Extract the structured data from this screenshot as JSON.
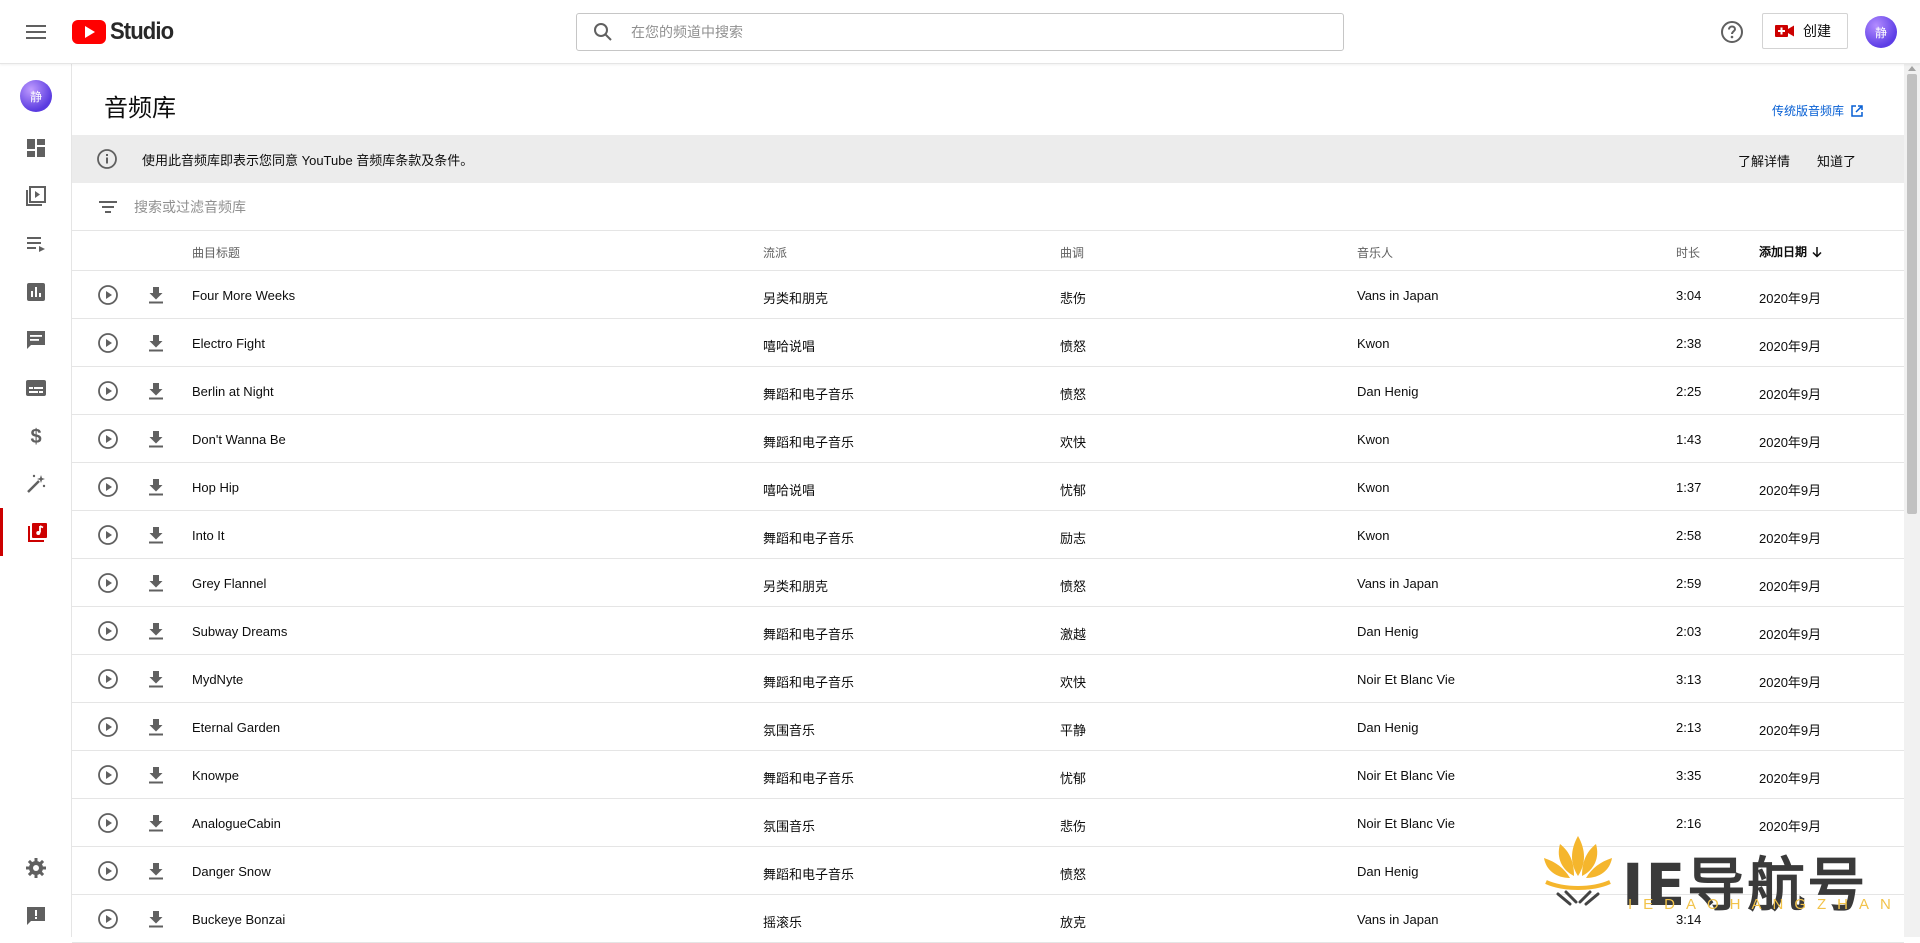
{
  "header": {
    "logo_text": "Studio",
    "search_placeholder": "在您的频道中搜索",
    "create_label": "创建",
    "avatar_text": "静"
  },
  "sidebar": {
    "avatar_text": "静",
    "items": [
      {
        "name": "dashboard"
      },
      {
        "name": "content"
      },
      {
        "name": "playlists"
      },
      {
        "name": "analytics"
      },
      {
        "name": "comments"
      },
      {
        "name": "subtitles"
      },
      {
        "name": "monetization"
      },
      {
        "name": "customization"
      },
      {
        "name": "audio-library",
        "active": true
      }
    ]
  },
  "page": {
    "title": "音频库",
    "legacy_link": "传统版音频库",
    "notice_text": "使用此音频库即表示您同意 YouTube 音频库条款及条件。",
    "learn_more": "了解详情",
    "got_it": "知道了",
    "filter_placeholder": "搜索或过滤音频库"
  },
  "table": {
    "headers": {
      "title": "曲目标题",
      "genre": "流派",
      "mood": "曲调",
      "artist": "音乐人",
      "duration": "时长",
      "date": "添加日期"
    },
    "rows": [
      {
        "title": "Four More Weeks",
        "genre": "另类和朋克",
        "mood": "悲伤",
        "artist": "Vans in Japan",
        "duration": "3:04",
        "date": "2020年9月"
      },
      {
        "title": "Electro Fight",
        "genre": "嘻哈说唱",
        "mood": "愤怒",
        "artist": "Kwon",
        "duration": "2:38",
        "date": "2020年9月"
      },
      {
        "title": "Berlin at Night",
        "genre": "舞蹈和电子音乐",
        "mood": "愤怒",
        "artist": "Dan Henig",
        "duration": "2:25",
        "date": "2020年9月"
      },
      {
        "title": "Don't Wanna Be",
        "genre": "舞蹈和电子音乐",
        "mood": "欢快",
        "artist": "Kwon",
        "duration": "1:43",
        "date": "2020年9月"
      },
      {
        "title": "Hop Hip",
        "genre": "嘻哈说唱",
        "mood": "忧郁",
        "artist": "Kwon",
        "duration": "1:37",
        "date": "2020年9月"
      },
      {
        "title": "Into It",
        "genre": "舞蹈和电子音乐",
        "mood": "励志",
        "artist": "Kwon",
        "duration": "2:58",
        "date": "2020年9月"
      },
      {
        "title": "Grey Flannel",
        "genre": "另类和朋克",
        "mood": "愤怒",
        "artist": "Vans in Japan",
        "duration": "2:59",
        "date": "2020年9月"
      },
      {
        "title": "Subway Dreams",
        "genre": "舞蹈和电子音乐",
        "mood": "激越",
        "artist": "Dan Henig",
        "duration": "2:03",
        "date": "2020年9月"
      },
      {
        "title": "MydNyte",
        "genre": "舞蹈和电子音乐",
        "mood": "欢快",
        "artist": "Noir Et Blanc Vie",
        "duration": "3:13",
        "date": "2020年9月"
      },
      {
        "title": "Eternal Garden",
        "genre": "氛围音乐",
        "mood": "平静",
        "artist": "Dan Henig",
        "duration": "2:13",
        "date": "2020年9月"
      },
      {
        "title": "Knowpe",
        "genre": "舞蹈和电子音乐",
        "mood": "忧郁",
        "artist": "Noir Et Blanc Vie",
        "duration": "3:35",
        "date": "2020年9月"
      },
      {
        "title": "AnalogueCabin",
        "genre": "氛围音乐",
        "mood": "悲伤",
        "artist": "Noir Et Blanc Vie",
        "duration": "2:16",
        "date": "2020年9月"
      },
      {
        "title": "Danger Snow",
        "genre": "舞蹈和电子音乐",
        "mood": "愤怒",
        "artist": "Dan Henig",
        "duration": "",
        "date": ""
      },
      {
        "title": "Buckeye Bonzai",
        "genre": "摇滚乐",
        "mood": "放克",
        "artist": "Vans in Japan",
        "duration": "3:14",
        "date": ""
      }
    ]
  },
  "watermark": {
    "text": "IE导航号",
    "sub": "IEDAOHANGZHAN"
  },
  "colors": {
    "brand_red": "#ff0000",
    "active_accent": "#cc0000",
    "link_blue": "#065fd4",
    "watermark_gold": "#f2c34a"
  }
}
